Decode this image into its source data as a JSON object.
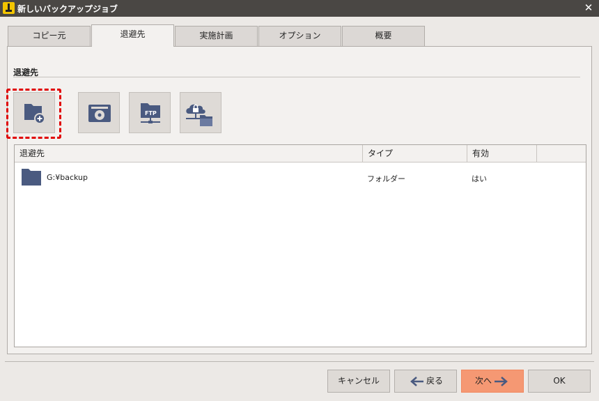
{
  "window": {
    "title": "新しいバックアップジョブ",
    "close_glyph": "✕"
  },
  "tabs": [
    {
      "label": "コピー元",
      "active": false
    },
    {
      "label": "退避先",
      "active": true
    },
    {
      "label": "実施計画",
      "active": false
    },
    {
      "label": "オプション",
      "active": false
    },
    {
      "label": "概要",
      "active": false
    }
  ],
  "section": {
    "title": "退避先"
  },
  "destination_types": [
    {
      "icon": "folder-add-icon",
      "highlighted": true
    },
    {
      "icon": "disk-icon",
      "highlighted": false
    },
    {
      "icon": "ftp-folder-icon",
      "highlighted": false
    },
    {
      "icon": "cloud-network-folder-icon",
      "highlighted": false
    }
  ],
  "table": {
    "columns": [
      "退避先",
      "タイプ",
      "有効",
      ""
    ],
    "rows": [
      {
        "icon": "folder-icon",
        "path": "G:¥backup",
        "type": "フォルダー",
        "enabled": "はい"
      }
    ]
  },
  "footer": {
    "cancel": "キャンセル",
    "back": "戻る",
    "next": "次へ",
    "ok": "OK"
  },
  "colors": {
    "titlebar": "#4a4744",
    "accent": "#f59873",
    "icon_blue": "#4a5a80",
    "highlight": "#e00000"
  }
}
